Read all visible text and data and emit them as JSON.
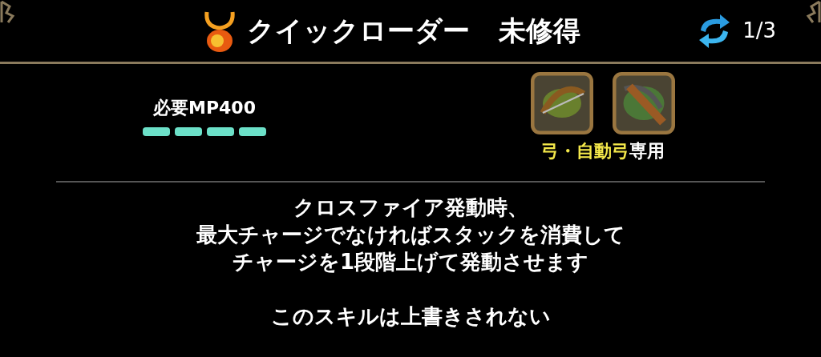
{
  "header": {
    "skill_name": "クイックローダー",
    "status": "未修得",
    "page": "1/3"
  },
  "cost": {
    "label": "必要MP400",
    "pips": [
      {
        "filled": true
      },
      {
        "filled": true
      },
      {
        "filled": true
      },
      {
        "filled": true
      }
    ]
  },
  "weapons": {
    "items": [
      {
        "kind": "bow"
      },
      {
        "kind": "crossbow"
      }
    ],
    "names": "弓・自動弓",
    "suffix": "専用"
  },
  "description": {
    "lines": [
      "クロスファイア発動時、",
      "最大チャージでなければスタックを消費して",
      "チャージを1段階上げて発動させます"
    ],
    "note": "このスキルは上書きされない"
  }
}
